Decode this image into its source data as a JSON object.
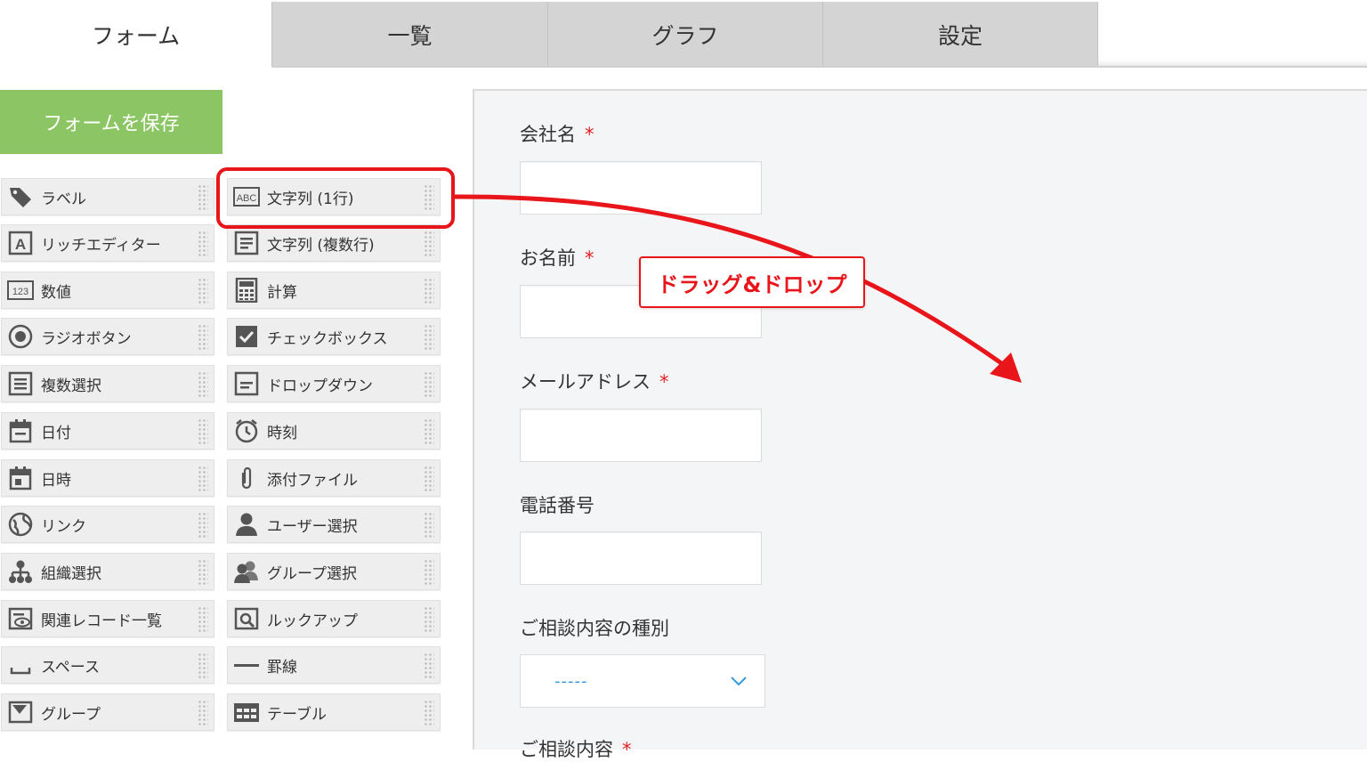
{
  "tabs": [
    {
      "label": "フォーム",
      "active": true
    },
    {
      "label": "一覧",
      "active": false
    },
    {
      "label": "グラフ",
      "active": false
    },
    {
      "label": "設定",
      "active": false
    }
  ],
  "save_button": {
    "label": "フォームを保存"
  },
  "palette": {
    "left": [
      {
        "label": "ラベル",
        "icon": "tag-icon"
      },
      {
        "label": "リッチエディター",
        "icon": "rich-text-icon"
      },
      {
        "label": "数値",
        "icon": "number-icon"
      },
      {
        "label": "ラジオボタン",
        "icon": "radio-icon"
      },
      {
        "label": "複数選択",
        "icon": "multi-select-icon"
      },
      {
        "label": "日付",
        "icon": "calendar-icon"
      },
      {
        "label": "日時",
        "icon": "calendar-time-icon"
      },
      {
        "label": "リンク",
        "icon": "globe-icon"
      },
      {
        "label": "組織選択",
        "icon": "org-icon"
      },
      {
        "label": "関連レコード一覧",
        "icon": "related-records-icon"
      },
      {
        "label": "スペース",
        "icon": "space-icon"
      },
      {
        "label": "グループ",
        "icon": "group-field-icon"
      }
    ],
    "right": [
      {
        "label": "文字列 (1行)",
        "icon": "abc-icon"
      },
      {
        "label": "文字列 (複数行)",
        "icon": "multiline-text-icon"
      },
      {
        "label": "計算",
        "icon": "calculator-icon"
      },
      {
        "label": "チェックボックス",
        "icon": "checkbox-icon"
      },
      {
        "label": "ドロップダウン",
        "icon": "dropdown-icon"
      },
      {
        "label": "時刻",
        "icon": "clock-icon"
      },
      {
        "label": "添付ファイル",
        "icon": "paperclip-icon"
      },
      {
        "label": "ユーザー選択",
        "icon": "user-icon"
      },
      {
        "label": "グループ選択",
        "icon": "users-icon"
      },
      {
        "label": "ルックアップ",
        "icon": "lookup-icon"
      },
      {
        "label": "罫線",
        "icon": "line-icon"
      },
      {
        "label": "テーブル",
        "icon": "table-icon"
      }
    ]
  },
  "form_fields": [
    {
      "label": "会社名",
      "required": "*"
    },
    {
      "label": "お名前",
      "required": "*"
    },
    {
      "label": "メールアドレス",
      "required": "*"
    },
    {
      "label": "電話番号",
      "required": ""
    },
    {
      "label": "ご相談内容の種別",
      "required": "",
      "select_value": "-----"
    },
    {
      "label": "ご相談内容",
      "required": "*"
    }
  ],
  "annotation": {
    "callout": "ドラッグ&ドロップ",
    "color": "#e8161b"
  },
  "colors": {
    "save_green": "#8cc563",
    "tab_inactive": "#d4d4d4",
    "canvas_bg": "#f4f5f7",
    "required_red": "#e02020",
    "select_blue": "#3498db"
  }
}
